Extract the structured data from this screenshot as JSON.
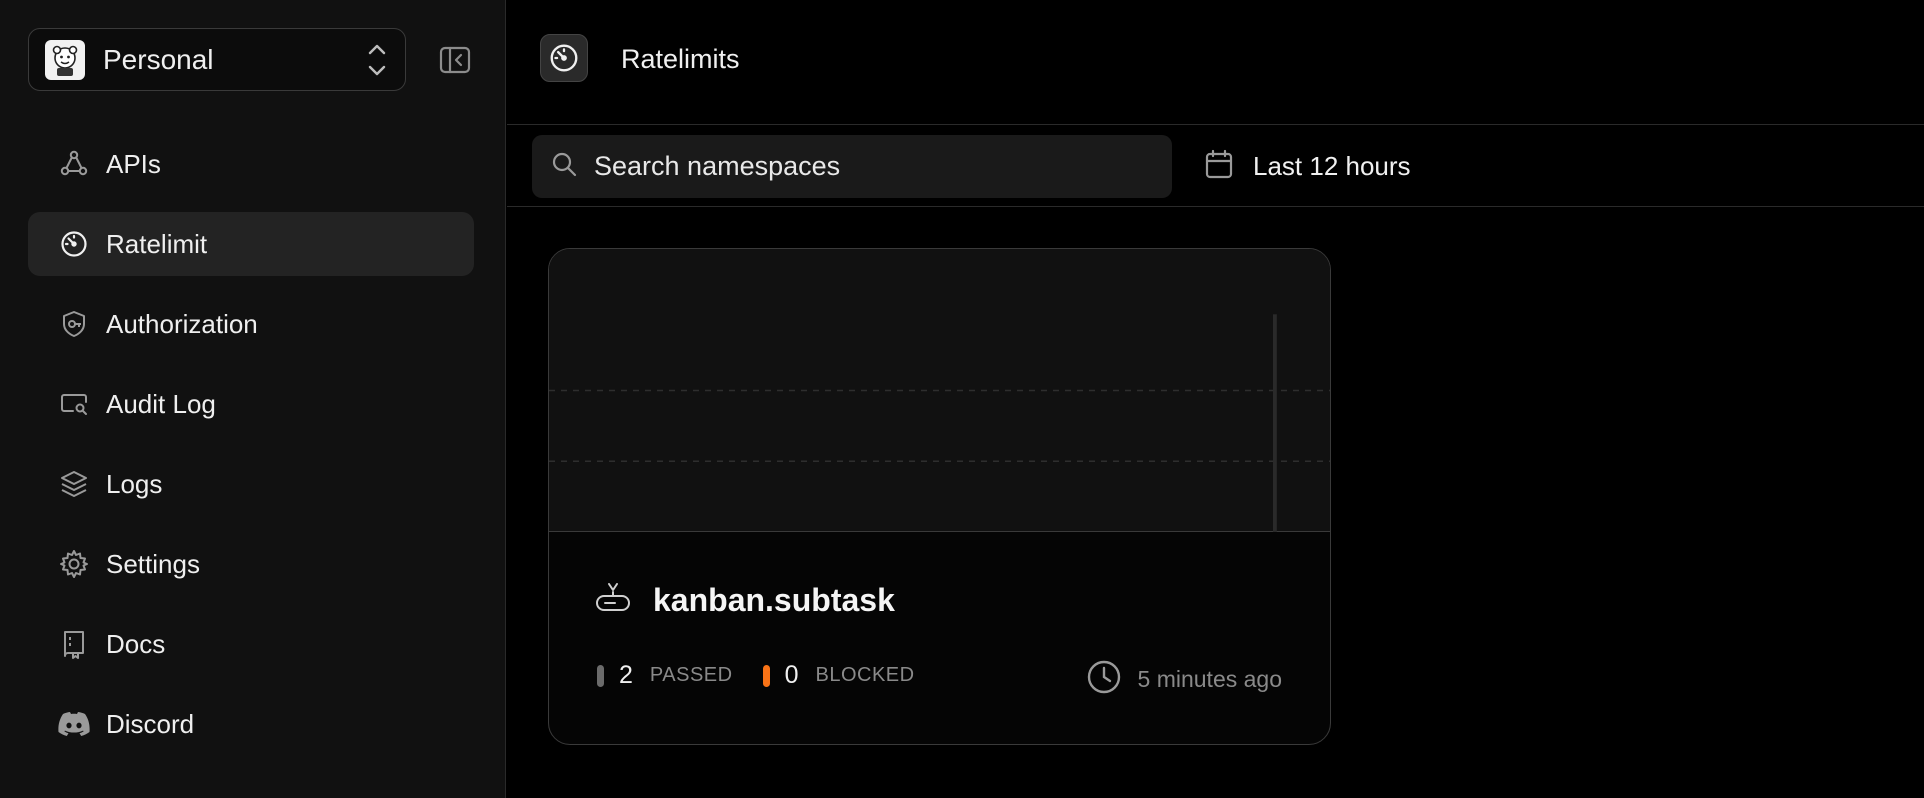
{
  "workspace": {
    "name": "Personal"
  },
  "sidebar": {
    "items": [
      {
        "label": "APIs",
        "icon": "nodes-icon",
        "active": false
      },
      {
        "label": "Ratelimit",
        "icon": "gauge-icon",
        "active": true
      },
      {
        "label": "Authorization",
        "icon": "shield-key-icon",
        "active": false
      },
      {
        "label": "Audit Log",
        "icon": "monitor-search-icon",
        "active": false
      },
      {
        "label": "Logs",
        "icon": "layers-icon",
        "active": false
      },
      {
        "label": "Settings",
        "icon": "gear-icon",
        "active": false
      },
      {
        "label": "Docs",
        "icon": "book-icon",
        "active": false
      },
      {
        "label": "Discord",
        "icon": "discord-icon",
        "active": false
      }
    ]
  },
  "header": {
    "title": "Ratelimits"
  },
  "toolbar": {
    "search_placeholder": "Search namespaces",
    "date_range": "Last 12 hours"
  },
  "namespaces": [
    {
      "name": "kanban.subtask",
      "passed": "2",
      "passed_label": "PASSED",
      "blocked": "0",
      "blocked_label": "BLOCKED",
      "last_used": "5 minutes ago",
      "colors": {
        "passed": "#6b6b6b",
        "blocked": "#f97316"
      },
      "chart_data": {
        "type": "bar",
        "note_type": "stacked",
        "series": [
          {
            "values": [
              0,
              0,
              0,
              0,
              0,
              0,
              0,
              0,
              0,
              0,
              0,
              0,
              0,
              0,
              0,
              0,
              0,
              0,
              0,
              0,
              0,
              0,
              0,
              0,
              0,
              0,
              0,
              0,
              0,
              0,
              0,
              0,
              0,
              0,
              0,
              0,
              0,
              0,
              0,
              0,
              0,
              0,
              0,
              0,
              0,
              0,
              0,
              0,
              0,
              0,
              0,
              0,
              0,
              0,
              0,
              0,
              0,
              0,
              0,
              0,
              0,
              0,
              0,
              0,
              0,
              0,
              0,
              0,
              0,
              0,
              0,
              0,
              0,
              0,
              0,
              0,
              0,
              0,
              0,
              0,
              0,
              0,
              0,
              0,
              0,
              0,
              0,
              0,
              0,
              0,
              0,
              0,
              0,
              0,
              0,
              0,
              0,
              0,
              0,
              0,
              0,
              0,
              0,
              0,
              0,
              0,
              0,
              0,
              0,
              0,
              0,
              0,
              0,
              0,
              0,
              0,
              0,
              0,
              0,
              0,
              0,
              0,
              0,
              0,
              0,
              0,
              0,
              0,
              0,
              0,
              0,
              0,
              0,
              2,
              0,
              0,
              0,
              0,
              0,
              0,
              0,
              0,
              0,
              0
            ]
          }
        ],
        "ylim": [
          0,
          2.6
        ],
        "grid": true,
        "colors": [
          "#2a2a2a"
        ]
      }
    }
  ]
}
